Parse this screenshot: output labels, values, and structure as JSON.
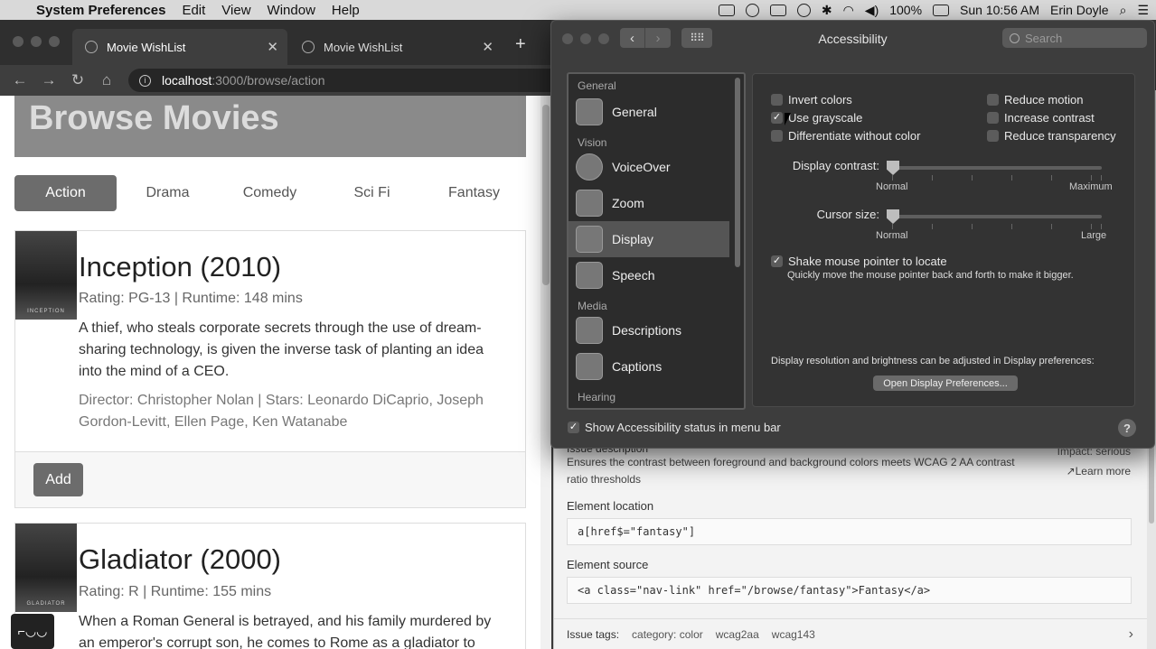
{
  "menubar": {
    "app": "System Preferences",
    "items": [
      "Edit",
      "View",
      "Window",
      "Help"
    ],
    "battery": "100%",
    "clock": "Sun 10:56 AM",
    "user": "Erin Doyle"
  },
  "browser": {
    "tabs": [
      {
        "label": "Movie WishList"
      },
      {
        "label": "Movie WishList"
      }
    ],
    "url_host": "localhost",
    "url_path": ":3000/browse/action"
  },
  "page": {
    "title": "Browse Movies",
    "genres": [
      "Action",
      "Drama",
      "Comedy",
      "Sci Fi",
      "Fantasy"
    ],
    "movies": [
      {
        "title": "Inception (2010)",
        "meta": "Rating: PG-13 | Runtime: 148 mins",
        "description": "A thief, who steals corporate secrets through the use of dream-sharing technology, is given the inverse task of planting an idea into the mind of a CEO.",
        "credits": "Director: Christopher Nolan | Stars: Leonardo DiCaprio, Joseph Gordon-Levitt, Ellen Page, Ken Watanabe",
        "poster_text": "INCEPTION",
        "add_label": "Add"
      },
      {
        "title": "Gladiator (2000)",
        "meta": "Rating: R | Runtime: 155 mins",
        "description": "When a Roman General is betrayed, and his family murdered by an emperor's corrupt son, he comes to Rome as a gladiator to",
        "poster_text": "GLADIATOR"
      }
    ]
  },
  "axe": {
    "impact": "Impact: serious",
    "issue_heading": "Issue description",
    "issue_description": "Ensures the contrast between foreground and background colors meets WCAG 2 AA contrast ratio thresholds",
    "learn_more": "Learn more",
    "element_location_label": "Element location",
    "element_location": "a[href$=\"fantasy\"]",
    "element_source_label": "Element source",
    "element_source": "<a class=\"nav-link\" href=\"/browse/fantasy\">Fantasy</a>",
    "tags_label": "Issue tags:",
    "tags": [
      "category: color",
      "wcag2aa",
      "wcag143"
    ]
  },
  "syspref": {
    "title": "Accessibility",
    "search_placeholder": "Search",
    "sidebar": {
      "categories": {
        "general": "General",
        "vision": "Vision",
        "media": "Media",
        "hearing": "Hearing"
      },
      "items": [
        "General",
        "VoiceOver",
        "Zoom",
        "Display",
        "Speech",
        "Descriptions",
        "Captions"
      ]
    },
    "display": {
      "invert_colors": "Invert colors",
      "use_grayscale": "Use grayscale",
      "differentiate": "Differentiate without color",
      "reduce_motion": "Reduce motion",
      "increase_contrast": "Increase contrast",
      "reduce_transparency": "Reduce transparency",
      "contrast_label": "Display contrast:",
      "contrast_min": "Normal",
      "contrast_max": "Maximum",
      "cursor_label": "Cursor size:",
      "cursor_min": "Normal",
      "cursor_max": "Large",
      "shake_label": "Shake mouse pointer to locate",
      "shake_hint": "Quickly move the mouse pointer back and forth to make it bigger.",
      "resolution_text": "Display resolution and brightness can be adjusted in Display preferences:",
      "open_button": "Open Display Preferences..."
    },
    "status_label": "Show Accessibility status in menu bar",
    "help": "?"
  }
}
